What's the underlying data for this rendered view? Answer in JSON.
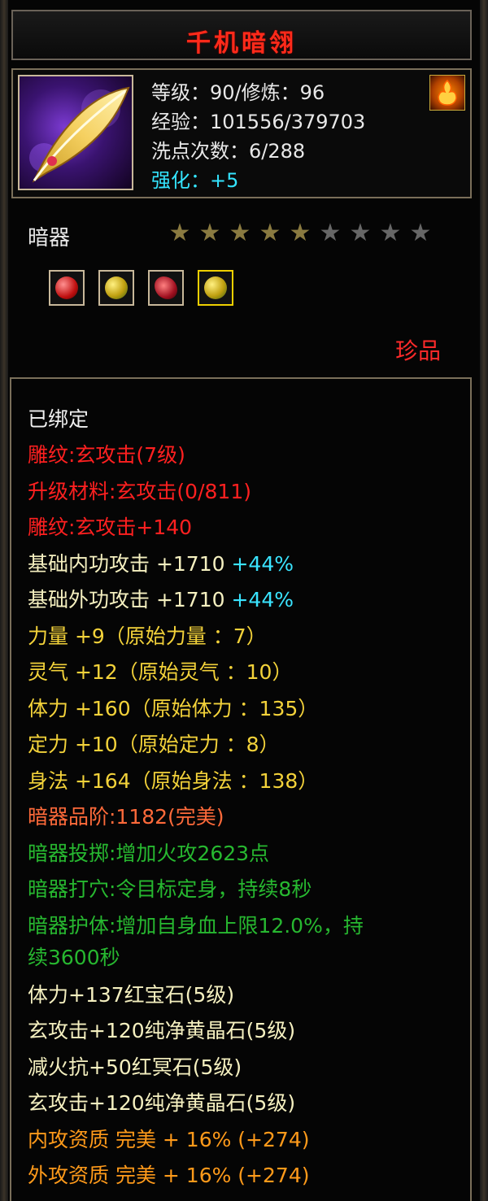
{
  "title": "千机暗翎",
  "item_info": {
    "level_line": "等级：90/修炼：96",
    "exp_line": "经验：101556/379703",
    "reset_line": "洗点次数：6/288",
    "enhance_line": "强化：+5"
  },
  "item_type": "暗器",
  "stars": {
    "filled": 5,
    "total": 9
  },
  "gems": [
    "red-gem-icon",
    "yellow-gem-icon",
    "red-crystal-icon",
    "yellow-gem-icon"
  ],
  "rarity": "珍品",
  "attributes": {
    "bound": "已绑定",
    "engrave1": "雕纹:玄攻击(7级)",
    "upgrade_material": "升级材料:玄攻击(0/811)",
    "engrave2": "雕纹:玄攻击+140",
    "inner_atk": "基础内功攻击 +1710 ",
    "inner_atk_pct": "+44%",
    "outer_atk": "基础外功攻击 +1710 ",
    "outer_atk_pct": "+44%",
    "strength": "力量 +9（原始力量 ：7）",
    "spirit": "灵气 +12（原始灵气 ：10）",
    "stamina": "体力 +160（原始体力 ：135）",
    "focus": "定力 +10（原始定力 ：8）",
    "agility": "身法 +164（原始身法 ：138）",
    "grade": "暗器品阶:1182(完美)",
    "throw": "暗器投掷:增加火攻2623点",
    "acupoint": "暗器打穴:令目标定身，持续8秒",
    "guard1": "暗器护体:增加自身血上限12.0%，持",
    "guard2": "续3600秒",
    "gem1": "体力+137红宝石(5级)",
    "gem2": "玄攻击+120纯净黄晶石(5级)",
    "gem3": "减火抗+50红冥石(5级)",
    "gem4": "玄攻击+120纯净黄晶石(5级)",
    "inner_quality": "内攻资质 完美 + 16% (+274)",
    "outer_quality": "外攻资质 完美 + 16% (+274)"
  }
}
